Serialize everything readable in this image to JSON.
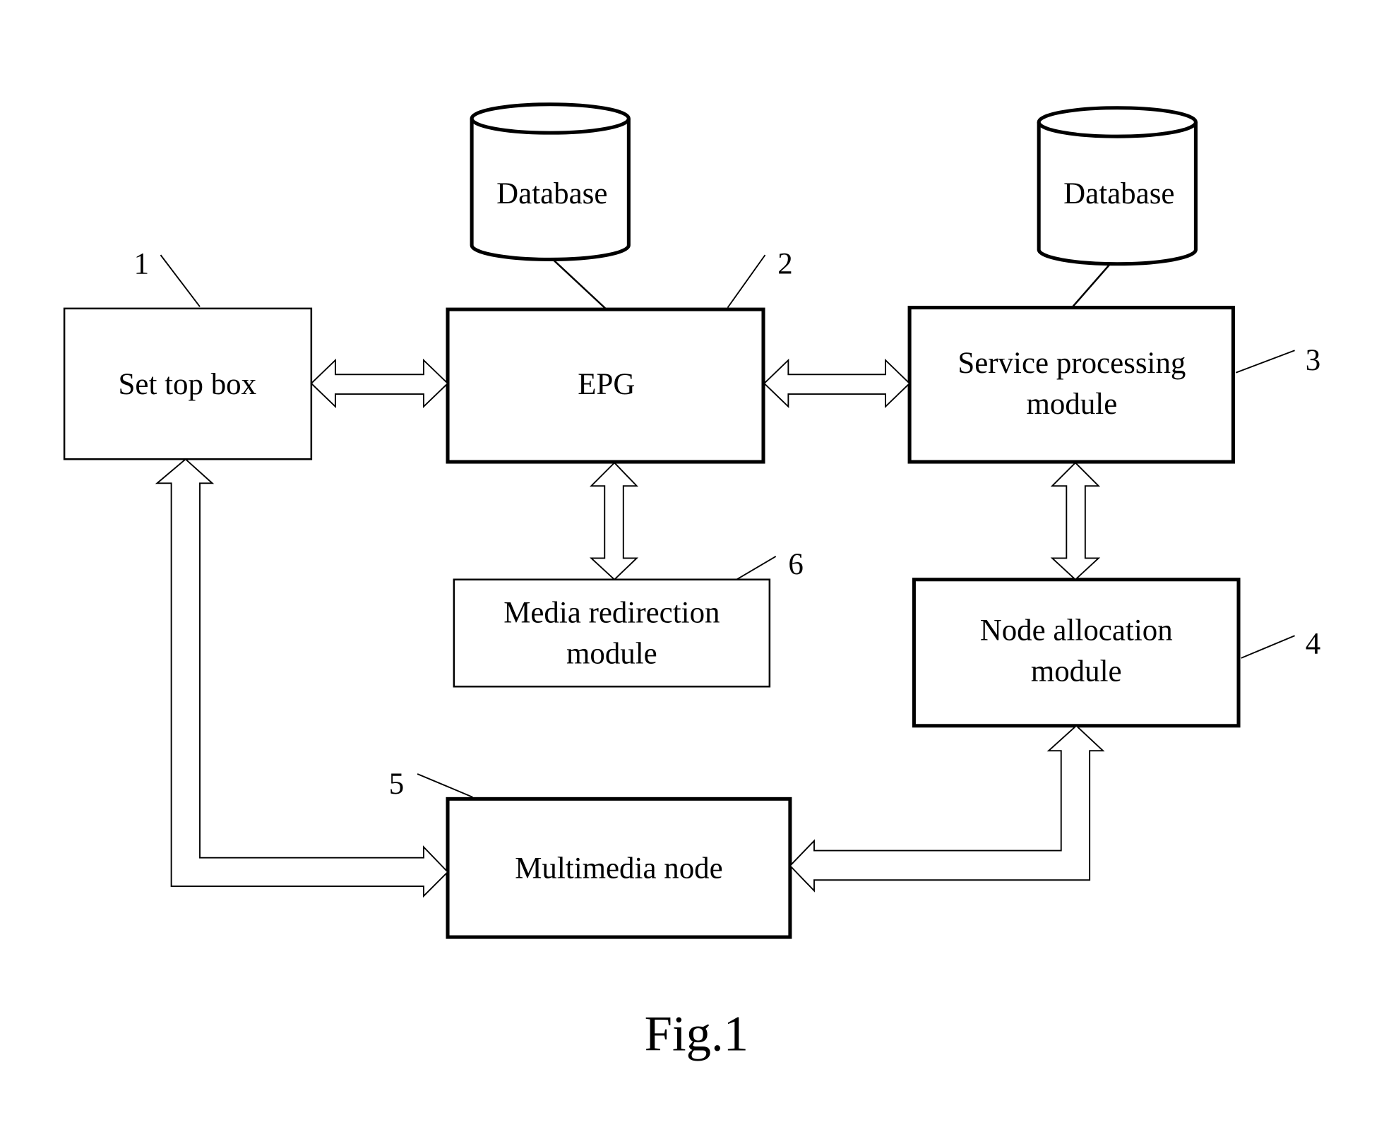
{
  "figure": {
    "caption": "Fig.1",
    "blocks": [
      {
        "id": "1",
        "label_lines": [
          "Set top box"
        ],
        "ref": "1"
      },
      {
        "id": "2",
        "label_lines": [
          "EPG"
        ],
        "ref": "2"
      },
      {
        "id": "3",
        "label_lines": [
          "Service processing",
          "module"
        ],
        "ref": "3"
      },
      {
        "id": "4",
        "label_lines": [
          "Node allocation",
          "module"
        ],
        "ref": "4"
      },
      {
        "id": "5",
        "label_lines": [
          "Multimedia node"
        ],
        "ref": "5"
      },
      {
        "id": "6",
        "label_lines": [
          "Media redirection",
          "module"
        ],
        "ref": "6"
      }
    ],
    "databases": [
      {
        "label": "Database",
        "attached_to": "EPG"
      },
      {
        "label": "Database",
        "attached_to": "Service processing module"
      }
    ],
    "connections": [
      {
        "from": "Set top box",
        "to": "EPG",
        "type": "bidirectional"
      },
      {
        "from": "EPG",
        "to": "Service processing module",
        "type": "bidirectional"
      },
      {
        "from": "EPG",
        "to": "Media redirection module",
        "type": "bidirectional"
      },
      {
        "from": "Service processing module",
        "to": "Node allocation module",
        "type": "bidirectional"
      },
      {
        "from": "Set top box",
        "to": "Multimedia node",
        "type": "bidirectional"
      },
      {
        "from": "Node allocation module",
        "to": "Multimedia node",
        "type": "bidirectional"
      }
    ]
  }
}
